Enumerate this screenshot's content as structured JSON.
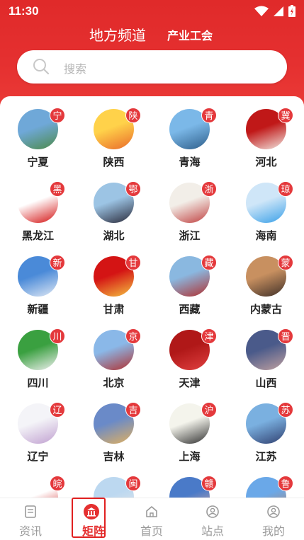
{
  "status_bar": {
    "time": "11:30"
  },
  "header": {
    "title": "地方频道",
    "subtitle": "产业工会"
  },
  "search": {
    "placeholder": "搜索"
  },
  "regions": [
    [
      {
        "name": "宁夏",
        "badge": "宁",
        "colors": [
          "#6fa8d8",
          "#4d8a4a"
        ]
      },
      {
        "name": "陕西",
        "badge": "陕",
        "colors": [
          "#ffd24a",
          "#e96a2a"
        ]
      },
      {
        "name": "青海",
        "badge": "青",
        "colors": [
          "#7bb8e8",
          "#2e5e8a"
        ]
      },
      {
        "name": "河北",
        "badge": "冀",
        "colors": [
          "#c01818",
          "#f2e6e0"
        ]
      }
    ],
    [
      {
        "name": "黑龙江",
        "badge": "黑",
        "colors": [
          "#ffffff",
          "#d41414"
        ]
      },
      {
        "name": "湖北",
        "badge": "鄂",
        "colors": [
          "#9cc4e4",
          "#2a2a3a"
        ]
      },
      {
        "name": "浙江",
        "badge": "浙",
        "colors": [
          "#f2eee8",
          "#c04040"
        ]
      },
      {
        "name": "海南",
        "badge": "琼",
        "colors": [
          "#cfe6f8",
          "#3aa0e8"
        ]
      }
    ],
    [
      {
        "name": "新疆",
        "badge": "新",
        "colors": [
          "#4a8ad8",
          "#dfe8f4"
        ]
      },
      {
        "name": "甘肃",
        "badge": "甘",
        "colors": [
          "#d41414",
          "#f4c040"
        ]
      },
      {
        "name": "西藏",
        "badge": "藏",
        "colors": [
          "#8ab8e0",
          "#b03030"
        ]
      },
      {
        "name": "内蒙古",
        "badge": "蒙",
        "colors": [
          "#c89060",
          "#403028"
        ]
      }
    ],
    [
      {
        "name": "四川",
        "badge": "川",
        "colors": [
          "#3aa040",
          "#f0f0f0"
        ]
      },
      {
        "name": "北京",
        "badge": "京",
        "colors": [
          "#8ab8e8",
          "#b03030"
        ]
      },
      {
        "name": "天津",
        "badge": "津",
        "colors": [
          "#b01818",
          "#e04040"
        ]
      },
      {
        "name": "山西",
        "badge": "晋",
        "colors": [
          "#4a5a8a",
          "#c0a0a0"
        ]
      }
    ],
    [
      {
        "name": "辽宁",
        "badge": "辽",
        "colors": [
          "#f4f4f8",
          "#c0a0d0"
        ]
      },
      {
        "name": "吉林",
        "badge": "吉",
        "colors": [
          "#6a8ac8",
          "#e0b060"
        ]
      },
      {
        "name": "上海",
        "badge": "沪",
        "colors": [
          "#f4f4ec",
          "#303030"
        ]
      },
      {
        "name": "江苏",
        "badge": "苏",
        "colors": [
          "#7ab0e0",
          "#304070"
        ]
      }
    ],
    [
      {
        "name": "",
        "badge": "皖",
        "colors": [
          "#ffffff",
          "#d02020"
        ]
      },
      {
        "name": "",
        "badge": "闽",
        "colors": [
          "#bcd8f0",
          "#e8e8e8"
        ]
      },
      {
        "name": "",
        "badge": "赣",
        "colors": [
          "#4a7ac8",
          "#e8b0a0"
        ]
      },
      {
        "name": "",
        "badge": "鲁",
        "colors": [
          "#6aa8e8",
          "#c08060"
        ]
      }
    ]
  ],
  "nav": {
    "items": [
      {
        "label": "资讯",
        "icon": "news-icon"
      },
      {
        "label": "矩阵",
        "icon": "matrix-icon"
      },
      {
        "label": "首页",
        "icon": "home-icon"
      },
      {
        "label": "站点",
        "icon": "site-icon"
      },
      {
        "label": "我的",
        "icon": "profile-icon"
      }
    ],
    "active_color": "#e53030",
    "inactive_color": "#999999"
  },
  "theme": {
    "primary": "#e53030"
  }
}
